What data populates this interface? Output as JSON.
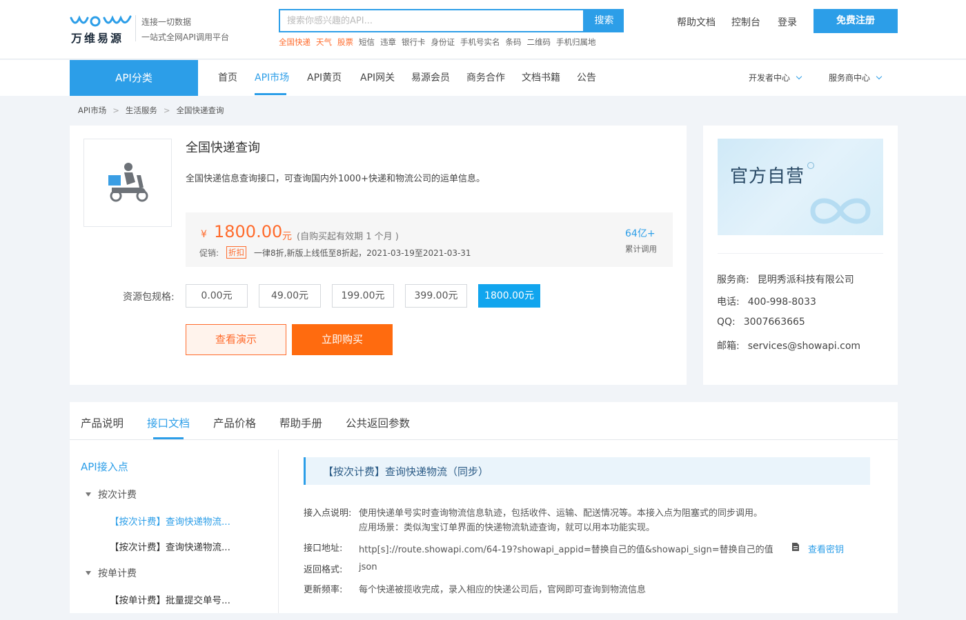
{
  "header": {
    "logo_name": "万维易源",
    "slogan_1": "连接一切数据",
    "slogan_2": "一站式全网API调用平台",
    "search_placeholder": "搜索你感兴趣的API...",
    "search_button": "搜索",
    "hot_words": [
      {
        "text": "全国快递",
        "hot": true
      },
      {
        "text": "天气",
        "hot": true
      },
      {
        "text": "股票",
        "hot": true
      },
      {
        "text": "短信",
        "hot": false
      },
      {
        "text": "违章",
        "hot": false
      },
      {
        "text": "银行卡",
        "hot": false
      },
      {
        "text": "身份证",
        "hot": false
      },
      {
        "text": "手机号实名",
        "hot": false
      },
      {
        "text": "条码",
        "hot": false
      },
      {
        "text": "二维码",
        "hot": false
      },
      {
        "text": "手机归属地",
        "hot": false
      }
    ],
    "links": {
      "help": "帮助文档",
      "console": "控制台",
      "login": "登录"
    },
    "register_button": "免费注册"
  },
  "nav": {
    "category": "API分类",
    "items": [
      "首页",
      "API市场",
      "API黄页",
      "API网关",
      "易源会员",
      "商务合作",
      "文档书籍",
      "公告"
    ],
    "active": "API市场",
    "dev_center": "开发者中心",
    "provider_center": "服务商中心"
  },
  "breadcrumb": [
    "API市场",
    "生活服务",
    "全国快递查询"
  ],
  "breadcrumb_sep": ">",
  "product": {
    "name": "全国快递查询",
    "description": "全国快递信息查询接口，可查询国内外1000+快递和物流公司的运单信息。",
    "price_symbol": "¥",
    "price": "1800.00",
    "price_unit": "元",
    "price_note": "(自购买起有效期 1 个月 )",
    "promo_label": "促销:",
    "promo_tag": "折扣",
    "promo_text": "一律8折,新版上线低至8折起，2021-03-19至2021-03-31",
    "calls_count": "64亿+",
    "calls_label": "累计调用",
    "spec_label": "资源包规格:",
    "specs": [
      "0.00元",
      "49.00元",
      "199.00元",
      "399.00元",
      "1800.00元"
    ],
    "selected_spec": "1800.00元",
    "demo_button": "查看演示",
    "buy_button": "立即购买"
  },
  "provider": {
    "banner_text": "官方自营",
    "vendor_label": "服务商:",
    "vendor": "昆明秀派科技有限公司",
    "phone_label": "电话:",
    "phone": "400-998-8033",
    "qq_label": "QQ:",
    "qq": "3007663665",
    "email_label": "邮箱:",
    "email": "services@showapi.com"
  },
  "tabs": [
    "产品说明",
    "接口文档",
    "产品价格",
    "帮助手册",
    "公共返回参数"
  ],
  "active_tab": "接口文档",
  "docnav": {
    "title": "API接入点",
    "groups": [
      {
        "label": "按次计费",
        "items": [
          "【按次计费】查询快递物流...",
          "【按次计费】查询快递物流..."
        ]
      },
      {
        "label": "按单计费",
        "items": [
          "【按单计费】批量提交单号..."
        ]
      }
    ]
  },
  "doc": {
    "title": "【按次计费】查询快递物流（同步）",
    "desc_label": "接入点说明:",
    "desc_1": "使用快递单号实时查询物流信息轨迹，包括收件、运输、配送情况等。本接入点为阻塞式的同步调用。",
    "desc_2": "应用场景：类似淘宝订单界面的快递物流轨迹查询，就可以用本功能实现。",
    "url_label": "接口地址:",
    "url": "http[s]://route.showapi.com/64-19?showapi_appid=替换自己的值&showapi_sign=替换自己的值",
    "view_key": "查看密钥",
    "format_label": "返回格式:",
    "format": "json",
    "freq_label": "更新频率:",
    "freq": "每个快递被揽收完成，录入相应的快递公司后，官网即可查询到物流信息"
  },
  "colors": {
    "primary": "#2c9ee8",
    "accent": "#ff6b2c",
    "buy": "#ff6b0f"
  }
}
